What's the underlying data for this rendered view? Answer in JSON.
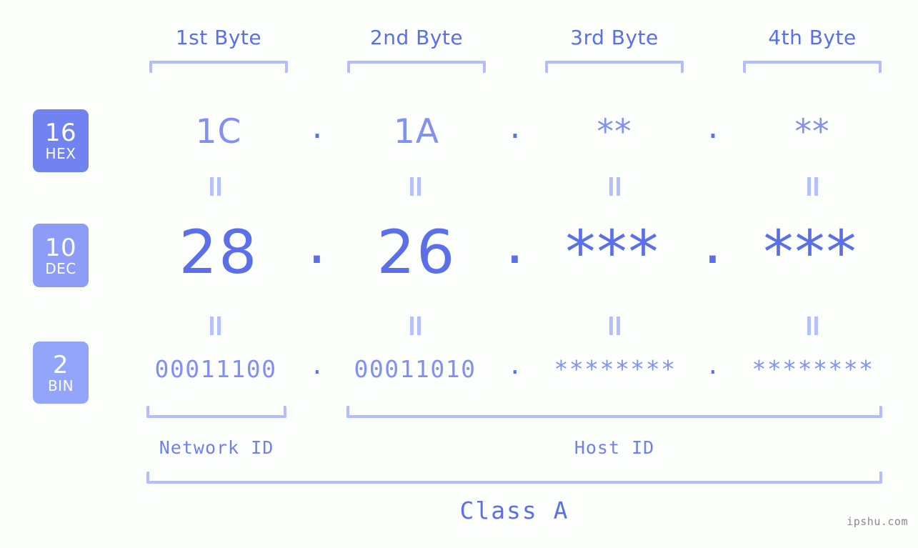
{
  "meta": {
    "background_color": "#fcfefc",
    "accent_color": "#5a6fe8",
    "light_accent_color": "#b3bdfb",
    "mid_accent_color": "#8290f2",
    "watermark": "ipshu.com"
  },
  "byte_headers": [
    {
      "label": "1st Byte"
    },
    {
      "label": "2nd Byte"
    },
    {
      "label": "3rd Byte"
    },
    {
      "label": "4th Byte"
    }
  ],
  "bases": [
    {
      "number": "16",
      "name": "HEX",
      "color": "#7183ef"
    },
    {
      "number": "10",
      "name": "DEC",
      "color": "#8d9cf6"
    },
    {
      "number": "2",
      "name": "BIN",
      "color": "#93a5fb"
    }
  ],
  "rows": {
    "hex": {
      "base_number": "16",
      "base_name": "HEX",
      "values": [
        "1C",
        "1A",
        "**",
        "**"
      ],
      "separators": [
        ".",
        ".",
        "."
      ]
    },
    "dec": {
      "base_number": "10",
      "base_name": "DEC",
      "values": [
        "28",
        "26",
        "***",
        "***"
      ],
      "separators": [
        ".",
        ".",
        "."
      ]
    },
    "bin": {
      "base_number": "2",
      "base_name": "BIN",
      "values": [
        "00011100",
        "00011010",
        "********",
        "********"
      ],
      "separators": [
        ".",
        ".",
        "."
      ]
    }
  },
  "equal_marks": {
    "glyph": "="
  },
  "sections": [
    {
      "label": "Network ID"
    },
    {
      "label": "Host ID"
    }
  ],
  "class": {
    "label": "Class A"
  }
}
